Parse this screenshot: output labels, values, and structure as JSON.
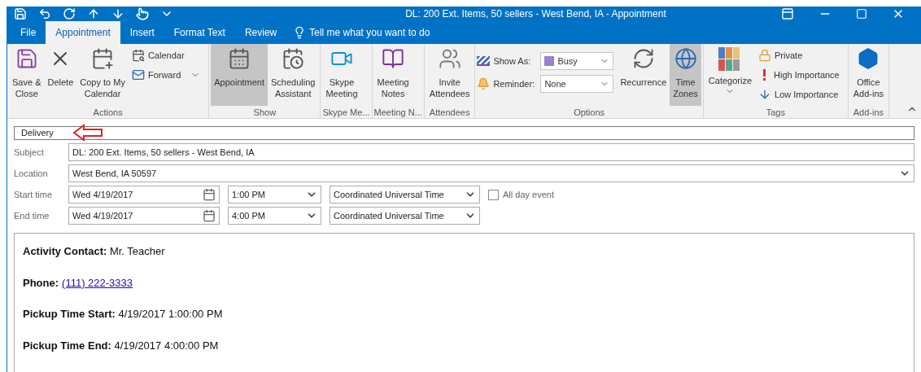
{
  "window": {
    "title": "DL:  200 Ext. Items, 50 sellers - West Bend, IA  -  Appointment"
  },
  "tabs": [
    {
      "label": "File",
      "selected": false
    },
    {
      "label": "Appointment",
      "selected": true
    },
    {
      "label": "Insert",
      "selected": false
    },
    {
      "label": "Format Text",
      "selected": false
    },
    {
      "label": "Review",
      "selected": false
    }
  ],
  "tell_me": "Tell me what you want to do",
  "ribbon_groups": [
    {
      "label": "Actions",
      "items": [
        {
          "kind": "large",
          "label": "Save &\nClose",
          "selected": false
        },
        {
          "kind": "large",
          "label": "Delete",
          "selected": false
        },
        {
          "kind": "large",
          "label": "Copy to My\nCalendar",
          "selected": false
        },
        {
          "kind": "stack",
          "items": [
            {
              "label": "Calendar",
              "dropdown": false
            },
            {
              "label": "Forward",
              "dropdown": true
            }
          ]
        }
      ]
    },
    {
      "label": "Show",
      "items": [
        {
          "kind": "large",
          "label": "Appointment",
          "selected": true
        },
        {
          "kind": "large",
          "label": "Scheduling\nAssistant",
          "selected": false
        }
      ]
    },
    {
      "label": "Skype Me...",
      "items": [
        {
          "kind": "large",
          "label": "Skype\nMeeting",
          "selected": false
        }
      ]
    },
    {
      "label": "Meeting N...",
      "items": [
        {
          "kind": "large",
          "label": "Meeting\nNotes",
          "selected": false
        }
      ]
    },
    {
      "label": "Attendees",
      "items": [
        {
          "kind": "large",
          "label": "Invite\nAttendees",
          "selected": false
        }
      ]
    },
    {
      "label": "Options",
      "items": [
        {
          "kind": "fields",
          "items": [
            {
              "label": "Show As:",
              "value": "Busy",
              "color": "#9b7fd4"
            },
            {
              "label": "Reminder:",
              "value": "None"
            }
          ]
        },
        {
          "kind": "large",
          "label": "Recurrence",
          "selected": false
        },
        {
          "kind": "large",
          "label": "Time\nZones",
          "selected": true
        }
      ]
    },
    {
      "label": "Tags",
      "items": [
        {
          "kind": "large",
          "label": "Categorize",
          "selected": false,
          "dropdown": true
        },
        {
          "kind": "stack",
          "items": [
            {
              "label": "Private",
              "dropdown": false
            },
            {
              "label": "High Importance",
              "dropdown": false
            },
            {
              "label": "Low Importance",
              "dropdown": false
            }
          ]
        }
      ]
    },
    {
      "label": "Add-ins",
      "items": [
        {
          "kind": "large",
          "label": "Office\nAdd-ins",
          "selected": false
        }
      ]
    }
  ],
  "category_bar": {
    "label": "Delivery"
  },
  "subject": {
    "label": "Subject",
    "value": "DL:  200 Ext. Items, 50 sellers - West Bend, IA"
  },
  "location": {
    "label": "Location",
    "value": "West Bend, IA 50597"
  },
  "times": [
    {
      "label": "Start time",
      "date": "Wed 4/19/2017",
      "time": "1:00 PM",
      "zone": "Coordinated Universal Time",
      "all_day": {
        "label": "All day event",
        "checked": false
      }
    },
    {
      "label": "End time",
      "date": "Wed 4/19/2017",
      "time": "4:00 PM",
      "zone": "Coordinated Universal Time"
    }
  ],
  "body": [
    {
      "kind": "text",
      "label": "Activity Contact:",
      "value": "Mr. Teacher"
    },
    {
      "kind": "link",
      "label": "Phone:",
      "value": "(111) 222-3333"
    },
    {
      "kind": "text",
      "label": "Pickup Time Start:",
      "value": "4/19/2017 1:00:00 PM"
    },
    {
      "kind": "text",
      "label": "Pickup Time End:",
      "value": "4/19/2017 4:00:00 PM"
    }
  ]
}
